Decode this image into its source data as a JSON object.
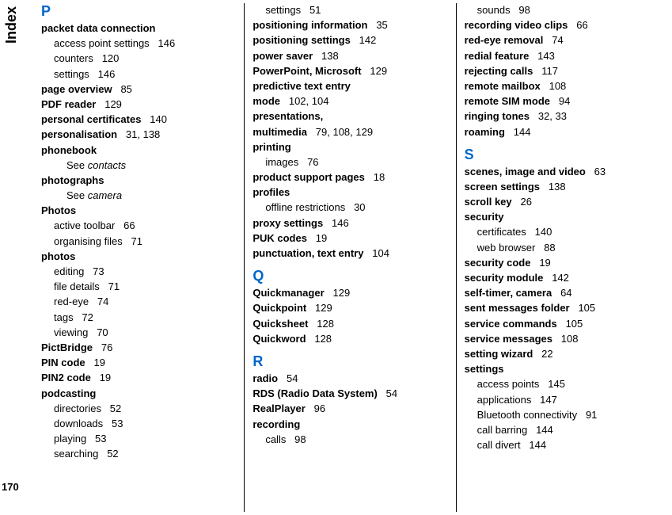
{
  "sideTab": "Index",
  "pageNumber": "170",
  "columns": [
    {
      "items": [
        {
          "type": "letter",
          "text": "P"
        },
        {
          "type": "bold",
          "text": "packet data connection"
        },
        {
          "type": "sub",
          "label": "access point settings",
          "page": "146"
        },
        {
          "type": "sub",
          "label": "counters",
          "page": "120"
        },
        {
          "type": "sub",
          "label": "settings",
          "page": "146"
        },
        {
          "type": "bold-page",
          "label": "page overview",
          "page": "85"
        },
        {
          "type": "bold-page",
          "label": "PDF reader",
          "page": "129"
        },
        {
          "type": "bold-page",
          "label": "personal certificates",
          "page": "140"
        },
        {
          "type": "bold-page",
          "label": "personalisation",
          "page": "31, 138"
        },
        {
          "type": "bold",
          "text": "phonebook"
        },
        {
          "type": "sub2-see",
          "prefix": "See ",
          "italic": "contacts"
        },
        {
          "type": "bold",
          "text": "photographs"
        },
        {
          "type": "sub2-see",
          "prefix": "See ",
          "italic": "camera"
        },
        {
          "type": "bold",
          "text": "Photos"
        },
        {
          "type": "sub",
          "label": "active toolbar",
          "page": "66"
        },
        {
          "type": "sub",
          "label": "organising files",
          "page": "71"
        },
        {
          "type": "bold",
          "text": "photos"
        },
        {
          "type": "sub",
          "label": "editing",
          "page": "73"
        },
        {
          "type": "sub",
          "label": "file details",
          "page": "71"
        },
        {
          "type": "sub",
          "label": "red-eye",
          "page": "74"
        },
        {
          "type": "sub",
          "label": "tags",
          "page": "72"
        },
        {
          "type": "sub",
          "label": "viewing",
          "page": "70"
        },
        {
          "type": "bold-page",
          "label": "PictBridge",
          "page": "76"
        },
        {
          "type": "bold-page",
          "label": "PIN code",
          "page": "19"
        },
        {
          "type": "bold-page",
          "label": "PIN2 code",
          "page": "19"
        },
        {
          "type": "bold",
          "text": "podcasting"
        },
        {
          "type": "sub",
          "label": "directories",
          "page": "52"
        },
        {
          "type": "sub",
          "label": "downloads",
          "page": "53"
        },
        {
          "type": "sub",
          "label": "playing",
          "page": "53"
        },
        {
          "type": "sub",
          "label": "searching",
          "page": "52"
        }
      ]
    },
    {
      "items": [
        {
          "type": "sub",
          "label": "settings",
          "page": "51"
        },
        {
          "type": "bold-page",
          "label": "positioning information",
          "page": "35"
        },
        {
          "type": "bold-page",
          "label": "positioning settings",
          "page": "142"
        },
        {
          "type": "bold-page",
          "label": "power saver",
          "page": "138"
        },
        {
          "type": "bold-page",
          "label": "PowerPoint, Microsoft",
          "page": "129"
        },
        {
          "type": "bold",
          "text": "predictive text entry"
        },
        {
          "type": "bold-page",
          "label": "mode",
          "page": "102, 104"
        },
        {
          "type": "bold",
          "text": "presentations,"
        },
        {
          "type": "bold-page",
          "label": "multimedia",
          "page": "79, 108, 129"
        },
        {
          "type": "bold",
          "text": "printing"
        },
        {
          "type": "sub",
          "label": "images",
          "page": "76"
        },
        {
          "type": "bold-page",
          "label": "product support pages",
          "page": "18"
        },
        {
          "type": "bold",
          "text": "profiles"
        },
        {
          "type": "sub",
          "label": "offline restrictions",
          "page": "30"
        },
        {
          "type": "bold-page",
          "label": "proxy settings",
          "page": "146"
        },
        {
          "type": "bold-page",
          "label": "PUK codes",
          "page": "19"
        },
        {
          "type": "bold-page",
          "label": "punctuation, text entry",
          "page": "104"
        },
        {
          "type": "gap"
        },
        {
          "type": "letter",
          "text": "Q"
        },
        {
          "type": "bold-page",
          "label": "Quickmanager",
          "page": "129"
        },
        {
          "type": "bold-page",
          "label": "Quickpoint",
          "page": "129"
        },
        {
          "type": "bold-page",
          "label": "Quicksheet",
          "page": "128"
        },
        {
          "type": "bold-page",
          "label": "Quickword",
          "page": "128"
        },
        {
          "type": "gap"
        },
        {
          "type": "letter",
          "text": "R"
        },
        {
          "type": "bold-page",
          "label": "radio",
          "page": "54"
        },
        {
          "type": "bold-page",
          "label": "RDS (Radio Data System)",
          "page": "54"
        },
        {
          "type": "bold-page",
          "label": "RealPlayer",
          "page": "96"
        },
        {
          "type": "bold",
          "text": "recording"
        },
        {
          "type": "sub",
          "label": "calls",
          "page": "98"
        }
      ]
    },
    {
      "items": [
        {
          "type": "sub",
          "label": "sounds",
          "page": "98"
        },
        {
          "type": "bold-page",
          "label": "recording video clips",
          "page": "66"
        },
        {
          "type": "bold-page",
          "label": "red-eye removal",
          "page": "74"
        },
        {
          "type": "bold-page",
          "label": "redial feature",
          "page": "143"
        },
        {
          "type": "bold-page",
          "label": "rejecting calls",
          "page": "117"
        },
        {
          "type": "bold-page",
          "label": "remote mailbox",
          "page": "108"
        },
        {
          "type": "bold-page",
          "label": "remote SIM mode",
          "page": "94"
        },
        {
          "type": "bold-page",
          "label": "ringing tones",
          "page": "32, 33"
        },
        {
          "type": "bold-page",
          "label": "roaming",
          "page": "144"
        },
        {
          "type": "gap"
        },
        {
          "type": "letter",
          "text": "S"
        },
        {
          "type": "bold-page",
          "label": "scenes, image and video",
          "page": "63"
        },
        {
          "type": "bold-page",
          "label": "screen settings",
          "page": "138"
        },
        {
          "type": "bold-page",
          "label": "scroll key",
          "page": "26"
        },
        {
          "type": "bold",
          "text": "security"
        },
        {
          "type": "sub",
          "label": "certificates",
          "page": "140"
        },
        {
          "type": "sub",
          "label": "web browser",
          "page": "88"
        },
        {
          "type": "bold-page",
          "label": "security code",
          "page": "19"
        },
        {
          "type": "bold-page",
          "label": "security module",
          "page": "142"
        },
        {
          "type": "bold-page",
          "label": "self-timer, camera",
          "page": "64"
        },
        {
          "type": "bold-page",
          "label": "sent messages folder",
          "page": "105"
        },
        {
          "type": "bold-page",
          "label": "service commands",
          "page": "105"
        },
        {
          "type": "bold-page",
          "label": "service messages",
          "page": "108"
        },
        {
          "type": "bold-page",
          "label": "setting wizard",
          "page": "22"
        },
        {
          "type": "bold",
          "text": "settings"
        },
        {
          "type": "sub",
          "label": "access points",
          "page": "145"
        },
        {
          "type": "sub",
          "label": "applications",
          "page": "147"
        },
        {
          "type": "sub",
          "label": "Bluetooth connectivity",
          "page": "91"
        },
        {
          "type": "sub",
          "label": "call barring",
          "page": "144"
        },
        {
          "type": "sub",
          "label": "call divert",
          "page": "144"
        }
      ]
    }
  ]
}
